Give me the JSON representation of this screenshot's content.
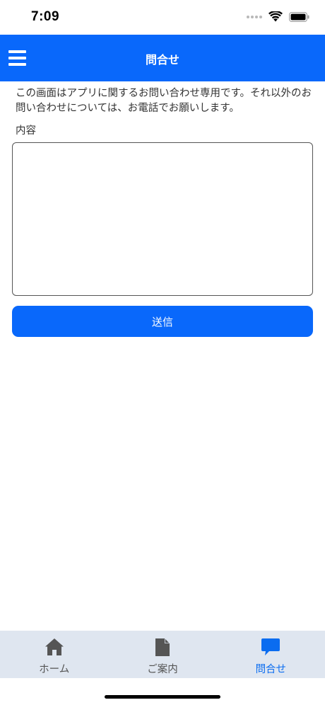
{
  "status_bar": {
    "time": "7:09"
  },
  "header": {
    "title": "問合せ",
    "menu_icon": "hamburger-menu-icon"
  },
  "form": {
    "notice": "この画面はアプリに関するお問い合わせ専用です。それ以外のお問い合わせについては、お電話でお願いします。",
    "content_label": "内容",
    "message_value": "",
    "send_label": "送信"
  },
  "tab_bar": {
    "items": [
      {
        "label": "ホーム",
        "icon": "home-icon",
        "active": false
      },
      {
        "label": "ご案内",
        "icon": "document-icon",
        "active": false
      },
      {
        "label": "問合せ",
        "icon": "chat-bubble-icon",
        "active": true
      }
    ]
  },
  "colors": {
    "primary": "#0968fb",
    "tab_bar_bg": "#dfe6f0",
    "tab_active": "#0a6cf0",
    "tab_inactive": "#555555"
  }
}
